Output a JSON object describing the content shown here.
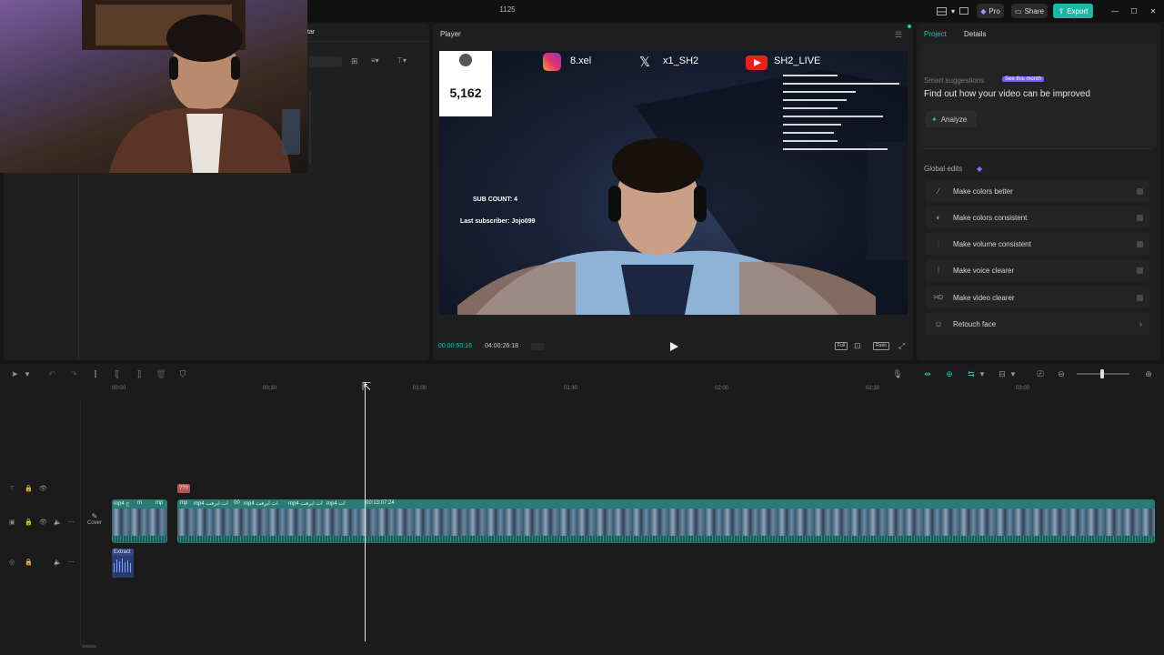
{
  "window": {
    "title": "1125",
    "pro_label": "Pro",
    "share_label": "Share",
    "export_label": "Export"
  },
  "media": {
    "tab_partial": "tar"
  },
  "player": {
    "header": "Player",
    "current_time": "00:00:50:16",
    "total_time": "04:00:26:18",
    "full_label": "Full",
    "ratio_label": "Ratio",
    "overlay": {
      "follower_count": "5,162",
      "instagram": "8.xel",
      "x_handle": "x1_SH2",
      "youtube": "SH2_LIVE",
      "sub_count": "SUB COUNT: 4",
      "last_subscriber": "Last subscriber: Jojo099"
    }
  },
  "properties": {
    "tabs": [
      "Project",
      "Details"
    ],
    "smart_suggestions_label": "Smart suggestions",
    "smart_badge": "See this month",
    "suggestion_text": "Find out how your video can be improved",
    "analyze_label": "Analyze",
    "global_edits_label": "Global edits",
    "global_edits": [
      {
        "label": "Make colors better",
        "icon": "wand-icon"
      },
      {
        "label": "Make colors consistent",
        "icon": "palette-icon"
      },
      {
        "label": "Make volume consistent",
        "icon": "equalizer-icon"
      },
      {
        "label": "Make voice clearer",
        "icon": "voice-icon"
      },
      {
        "label": "Make video clearer",
        "icon": "hd-icon"
      },
      {
        "label": "Retouch face",
        "icon": "face-icon"
      }
    ]
  },
  "timeline": {
    "ticks": [
      "00:00",
      "00:30",
      "01:00",
      "01:30",
      "02:00",
      "02:30",
      "03:00"
    ],
    "marker_label": "???",
    "cover_label": "Cover",
    "extract_label": "Extract",
    "clip_labels": [
      "mp4 خ",
      "m",
      "mp",
      "mp",
      "mp4 ات ايرفت",
      "00",
      "mp4 ات ايرفت",
      "mp4 ات ايرفت",
      "mp4 ات",
      "00:13:07:24"
    ]
  },
  "colors": {
    "accent": "#20c4b4",
    "export_bg": "#1fb6a6",
    "clip_bg": "#1f5c58",
    "youtube_red": "#e62117"
  }
}
